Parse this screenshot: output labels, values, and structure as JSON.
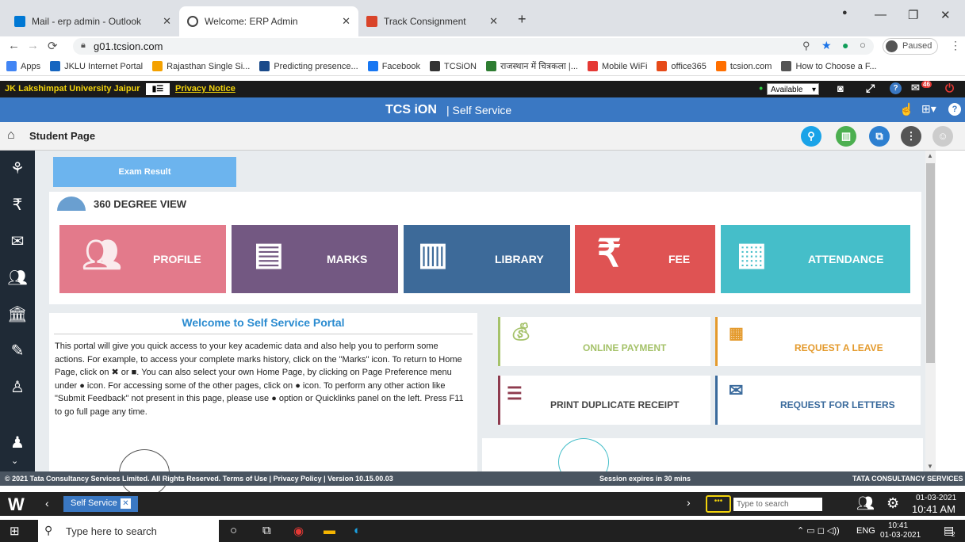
{
  "browser": {
    "tabs": [
      {
        "title": "Mail - erp admin - Outlook",
        "color": "#0078d4"
      },
      {
        "title": "Welcome: ERP Admin",
        "color": "#444444"
      },
      {
        "title": "Track Consignment",
        "color": "#d9442a"
      }
    ],
    "new_tab": "+",
    "url": "g01.tcsion.com",
    "profile_status": "Paused",
    "bookmarks": [
      {
        "label": "Apps",
        "color": "#4285f4"
      },
      {
        "label": "JKLU Internet Portal",
        "color": "#1565c0"
      },
      {
        "label": "Rajasthan Single Si...",
        "color": "#f4a100"
      },
      {
        "label": "Predicting presence...",
        "color": "#1a4a8a"
      },
      {
        "label": "Facebook",
        "color": "#1877f2"
      },
      {
        "label": "TCSiON",
        "color": "#333333"
      },
      {
        "label": "राजस्थान में चित्रकला |...",
        "color": "#2e7d32"
      },
      {
        "label": "Mobile WiFi",
        "color": "#e53935"
      },
      {
        "label": "office365",
        "color": "#e64a19"
      },
      {
        "label": "tcsion.com",
        "color": "#ff6f00"
      },
      {
        "label": "How to Choose a F...",
        "color": "#555555"
      }
    ]
  },
  "portal": {
    "university": "JK Lakshimpat University Jaipur",
    "privacy": "Privacy Notice",
    "status_select": "Available",
    "notif_count": "46",
    "brand": "TCS iON",
    "brand_sub": "| Self Service",
    "page_title": "Student Page",
    "exam_result": "Exam Result",
    "view_title": "360 DEGREE VIEW",
    "tiles": [
      {
        "label": "PROFILE",
        "color": "#e37a8b"
      },
      {
        "label": "MARKS",
        "color": "#735882"
      },
      {
        "label": "LIBRARY",
        "color": "#3d6a99"
      },
      {
        "label": "FEE",
        "color": "#df5353"
      },
      {
        "label": "ATTENDANCE",
        "color": "#45bec9"
      }
    ],
    "welcome_title": "Welcome to Self Service Portal",
    "welcome_text": "This portal will give you quick access to your key academic data and also help you to perform some actions. For example, to access your complete marks history, click on the \"Marks\" icon. To return to Home Page, click on ✖ or ■. You can also select your own Home Page, by clicking on Page Preference menu under ● icon. For accessing some of the other pages, click on ● icon. To perform any other action like \"Submit Feedback\" not present in this page, please use ● option or Quicklinks panel on the left. Press F11 to go full page any time.",
    "cards": [
      {
        "label": "ONLINE PAYMENT",
        "color": "#a5c26a",
        "border": "#a5c26a"
      },
      {
        "label": "REQUEST A LEAVE",
        "color": "#e49a2c",
        "border": "#e49a2c"
      },
      {
        "label": "PRINT DUPLICATE RECEIPT",
        "color": "#444444",
        "border": "#8e3b4e"
      },
      {
        "label": "REQUEST FOR LETTERS",
        "color": "#3a6a9c",
        "border": "#3a6a9c"
      }
    ],
    "footer_left": "© 2021 Tata Consultancy Services Limited. All Rights Reserved.   Terms of Use | Privacy Policy | Version 10.15.00.03",
    "footer_mid": "Session expires in 30 mins",
    "footer_right": "TATA CONSULTANCY SERVICES"
  },
  "wbar": {
    "tab": "Self Service",
    "search_placeholder": "Type to search",
    "date": "01-03-2021",
    "time": "10:41 AM"
  },
  "taskbar": {
    "search_placeholder": "Type here to search",
    "lang": "ENG",
    "time": "10:41",
    "date": "01-03-2021",
    "notif": "2"
  }
}
